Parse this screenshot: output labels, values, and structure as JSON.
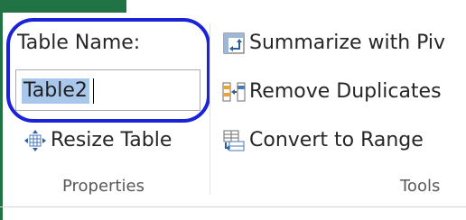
{
  "properties": {
    "table_name_label": "Table Name:",
    "table_name_value": "Table2",
    "resize_table_label": "Resize Table",
    "group_label": "Properties"
  },
  "tools": {
    "summarize_label": "Summarize with Piv",
    "remove_duplicates_label": "Remove Duplicates",
    "convert_to_range_label": "Convert to Range",
    "group_label": "Tools"
  },
  "icons": {
    "resize_table": "resize-table-icon",
    "summarize": "pivot-table-icon",
    "remove_duplicates": "remove-duplicates-icon",
    "convert_to_range": "convert-to-range-icon"
  },
  "colors": {
    "tab_accent": "#217346",
    "highlight_ring": "#1a24d6",
    "selection": "#a8c7ea"
  }
}
